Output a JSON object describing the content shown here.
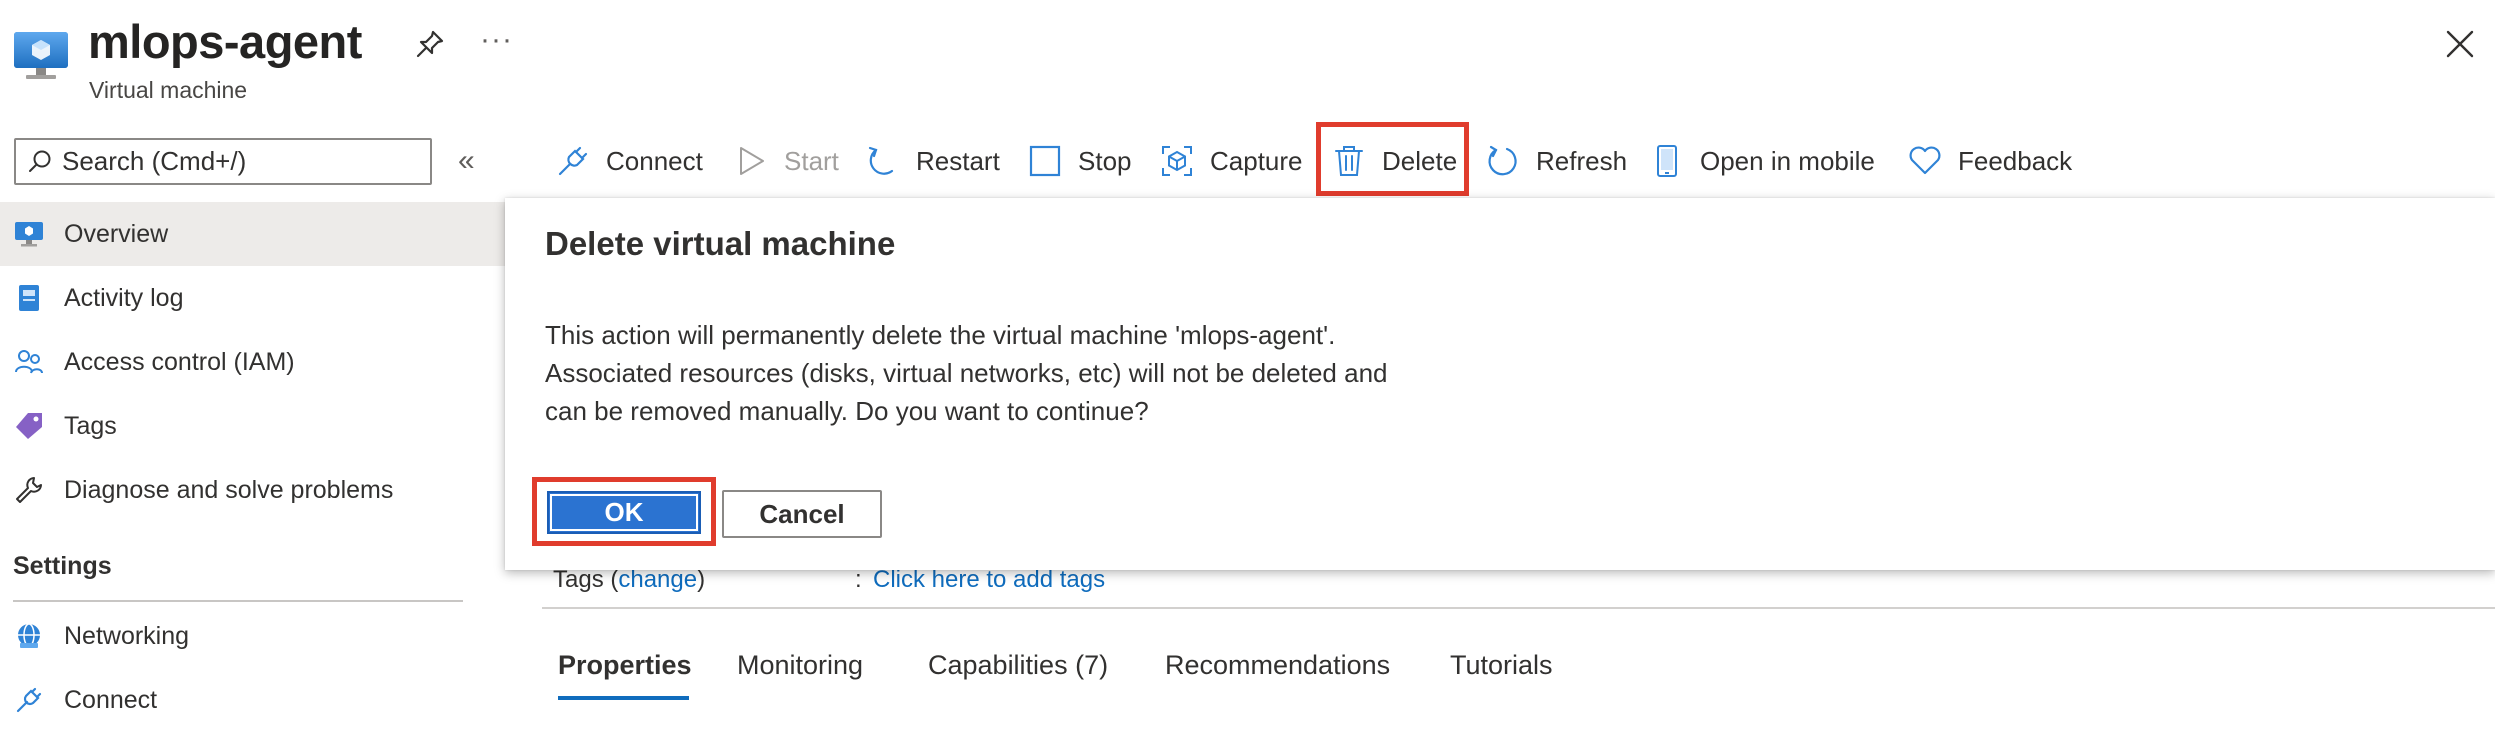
{
  "header": {
    "title": "mlops-agent",
    "subtitle": "Virtual machine",
    "more_label": "···"
  },
  "search": {
    "placeholder": "Search (Cmd+/)",
    "collapse_label": "«"
  },
  "sidebar": {
    "items": [
      {
        "label": "Overview",
        "icon": "vm-monitor-icon"
      },
      {
        "label": "Activity log",
        "icon": "activity-log-icon"
      },
      {
        "label": "Access control (IAM)",
        "icon": "people-icon"
      },
      {
        "label": "Tags",
        "icon": "tag-icon"
      },
      {
        "label": "Diagnose and solve problems",
        "icon": "wrench-icon"
      }
    ],
    "section_title": "Settings",
    "settings_items": [
      {
        "label": "Networking",
        "icon": "network-globe-icon"
      },
      {
        "label": "Connect",
        "icon": "plug-icon"
      }
    ]
  },
  "toolbar": {
    "connect": "Connect",
    "start": "Start",
    "restart": "Restart",
    "stop": "Stop",
    "capture": "Capture",
    "delete": "Delete",
    "refresh": "Refresh",
    "open_mobile": "Open in mobile",
    "feedback": "Feedback"
  },
  "background": {
    "tags_label": "Tags (",
    "tags_change": "change",
    "tags_close": ")",
    "colon": ":",
    "tags_add": "Click here to add tags",
    "tabs": [
      "Properties",
      "Monitoring",
      "Capabilities (7)",
      "Recommendations",
      "Tutorials"
    ]
  },
  "dialog": {
    "title": "Delete virtual machine",
    "body": "This action will permanently delete the virtual machine 'mlops-agent'.\nAssociated resources (disks, virtual networks, etc) will not be deleted and\ncan be removed manually. Do you want to continue?",
    "ok": "OK",
    "cancel": "Cancel"
  },
  "colors": {
    "accent": "#0f6cbd",
    "highlight": "#e03c2d",
    "ok_button": "#2b73d1"
  }
}
